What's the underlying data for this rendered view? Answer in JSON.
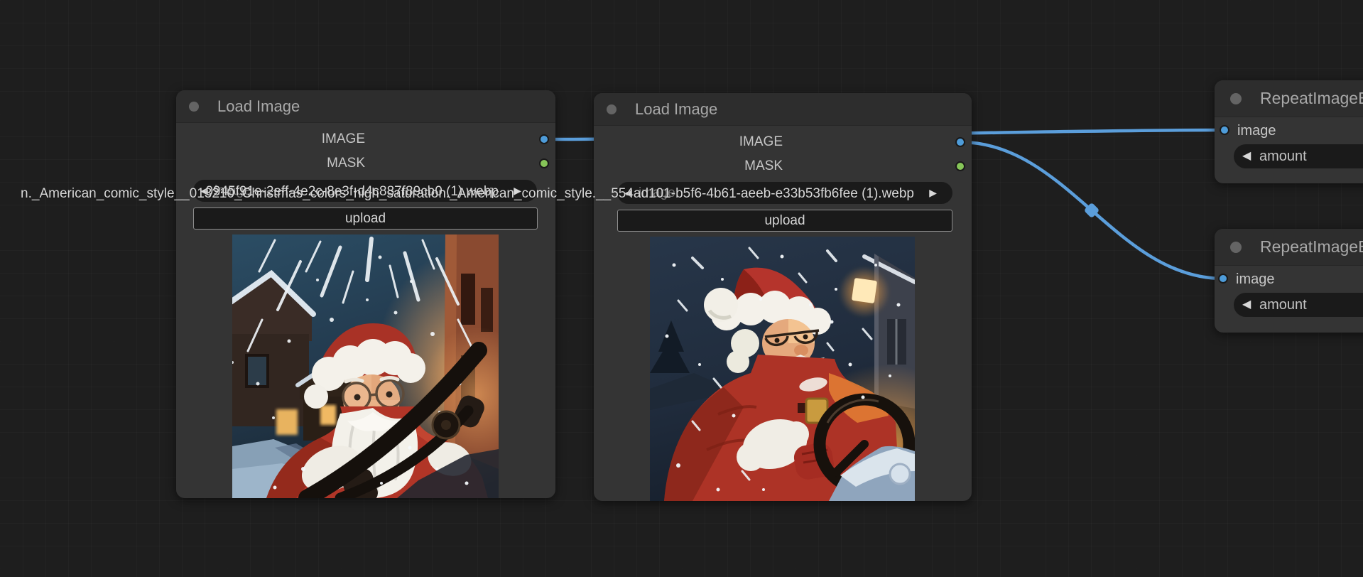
{
  "canvas": {
    "bg_color": "#1e1e1e",
    "wire_color": "#5b9edb"
  },
  "icons": {
    "left_arrow": "◀",
    "right_arrow": "▶"
  },
  "port_colors": {
    "image": "#4e9cd9",
    "mask": "#86c558"
  },
  "load_image_1": {
    "title": "Load Image",
    "output_image_label": "IMAGE",
    "output_mask_label": "MASK",
    "image_widget_label": "image",
    "image_filename": "0945f91e-2eff-4e2c-8e3f-d4c887f89cb0 (1).webp",
    "upload_label": "upload",
    "preview_alt": "comic-style Santa Claus in glasses driving through snowy night village"
  },
  "load_image_2": {
    "title": "Load Image",
    "output_image_label": "IMAGE",
    "output_mask_label": "MASK",
    "image_widget_label": "image",
    "image_filename": "n._American_comic_style__013210_Christmas_colors_high_saturation._American_comic_style.__554ad101-b5f6-4b61-aeeb-e33b53fb6fee (1).webp",
    "upload_label": "upload",
    "preview_alt": "comic-style Santa Claus smiling at steering wheel in night snowfall"
  },
  "repeat_image_1": {
    "title": "RepeatImageBatch",
    "input_image_label": "image",
    "amount_widget_label": "amount"
  },
  "repeat_image_2": {
    "title": "RepeatImageBatch",
    "input_image_label": "image",
    "amount_widget_label": "amount"
  }
}
